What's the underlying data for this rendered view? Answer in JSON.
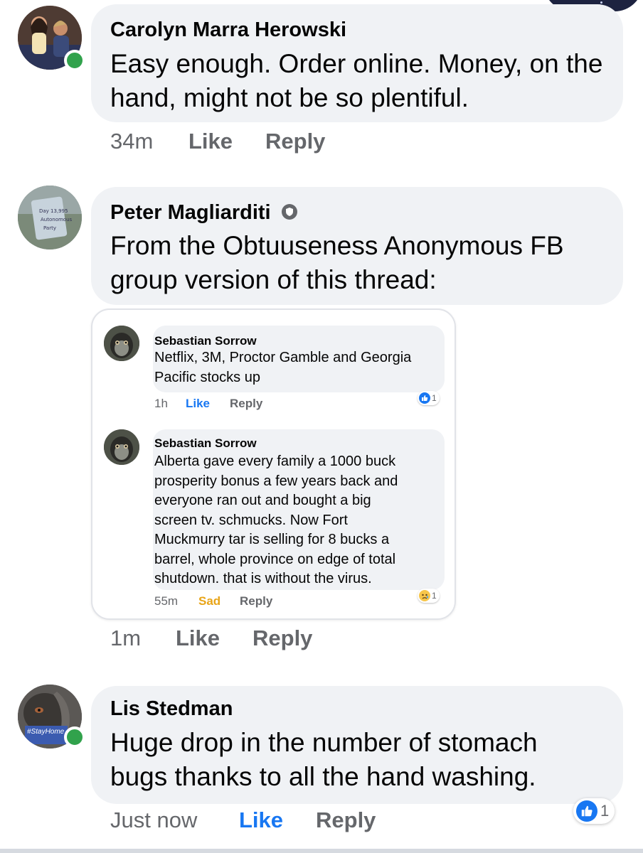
{
  "comments": [
    {
      "author": "Carolyn Marra Herowski",
      "text_lines": [
        "Easy enough. Order online. Money, on the",
        "hand, might not be so plentiful."
      ],
      "time": "34m",
      "like_label": "Like",
      "reply_label": "Reply",
      "online": true
    },
    {
      "author": "Peter Magliarditi",
      "text_lines": [
        "From the Obtuuseness Anonymous FB",
        "group version of this thread:"
      ],
      "time": "1m",
      "like_label": "Like",
      "reply_label": "Reply",
      "verified_badge": "shield-icon",
      "embedded": [
        {
          "author": "Sebastian Sorrow",
          "text_lines": [
            "Netflix, 3M, Proctor Gamble and Georgia",
            "Pacific stocks up"
          ],
          "time": "1h",
          "action_label": "Like",
          "reply_label": "Reply",
          "reaction": {
            "type": "like",
            "count": "1"
          }
        },
        {
          "author": "Sebastian Sorrow",
          "text_lines": [
            "Alberta gave every family a 1000 buck",
            "prosperity bonus a few years back and",
            "everyone ran out and bought a big",
            "screen tv. schmucks. Now Fort",
            "Muckmurry tar is selling for 8 bucks a",
            "barrel, whole province on edge of total",
            "shutdown. that is without the virus."
          ],
          "time": "55m",
          "action_label": "Sad",
          "reply_label": "Reply",
          "reaction": {
            "type": "sad",
            "count": "1"
          }
        }
      ]
    },
    {
      "author": "Lis Stedman",
      "text_lines": [
        "Huge drop in the number of stomach",
        "bugs thanks to all the hand washing."
      ],
      "time": "Just now",
      "like_label": "Like",
      "reply_label": "Reply",
      "online": true,
      "avatar_badge_text": "#StayHome",
      "reaction": {
        "type": "like",
        "count": "1"
      }
    }
  ],
  "colors": {
    "bubble": "#f0f2f5",
    "meta_gray": "#65676b",
    "like_blue": "#1877f2",
    "online_green": "#31a24c",
    "sad_yellow": "#e8a417"
  }
}
